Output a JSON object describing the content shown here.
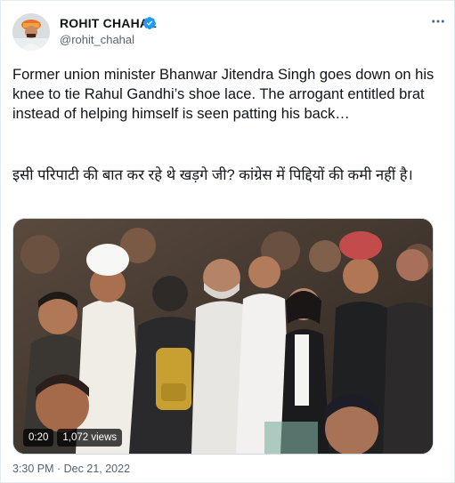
{
  "tweet": {
    "author": {
      "name": "ROHIT CHAHAL",
      "handle": "@rohit_chahal",
      "verified": true
    },
    "more_icon": "more-horizontal-icon",
    "text_english": "Former union minister Bhanwar Jitendra Singh goes down on his knee to tie Rahul Gandhi’s shoe lace. The arrogant entitled brat instead of helping himself is seen patting his back…",
    "text_hindi": "इसी परिपाटी की बात कर रहे थे खड़गे जी? कांग्रेस में पिद्दियों की कमी नहीं है।",
    "media": {
      "duration": "0:20",
      "views": "1,072 views"
    },
    "timestamp": "3:30 PM · Dec 21, 2022"
  },
  "colors": {
    "text": "#0f1419",
    "secondary": "#536471",
    "verified_blue": "#1d9bf0",
    "border": "#cfd9de"
  }
}
